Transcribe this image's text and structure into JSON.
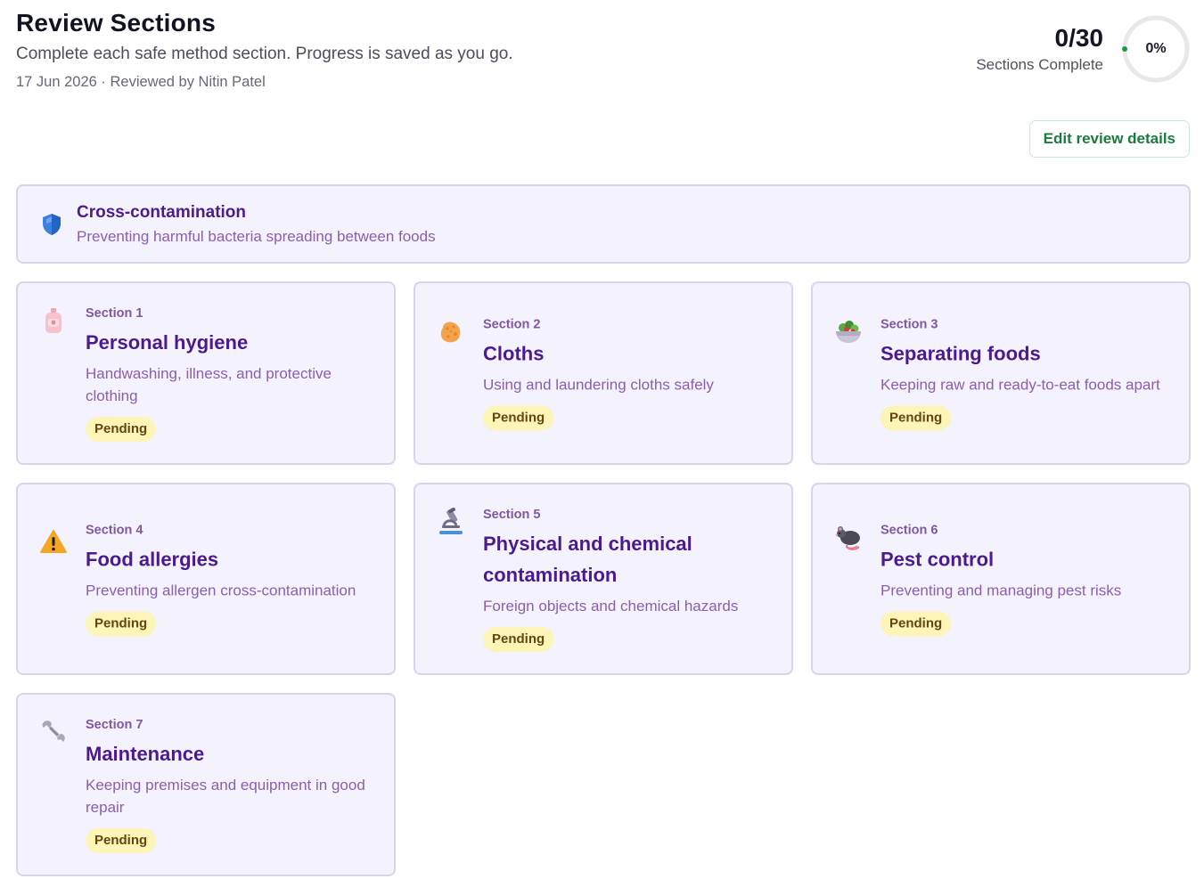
{
  "header": {
    "title": "Review Sections",
    "subtitle": "Complete each safe method section. Progress is saved as you go.",
    "meta": "17 Jun 2026 · Reviewed by Nitin Patel"
  },
  "progress": {
    "count": "0/30",
    "label": "Sections Complete",
    "percent_label": "0%",
    "percent": 0
  },
  "edit_button": {
    "label": "Edit review details"
  },
  "category": {
    "title": "Cross-contamination",
    "description": "Preventing harmful bacteria spreading between foods",
    "icon": "shield-icon"
  },
  "sections": [
    {
      "number": "Section 1",
      "title": "Personal hygiene",
      "description": "Handwashing, illness, and protective clothing",
      "status": "Pending",
      "icon": "soap-icon"
    },
    {
      "number": "Section 2",
      "title": "Cloths",
      "description": "Using and laundering cloths safely",
      "status": "Pending",
      "icon": "sponge-icon"
    },
    {
      "number": "Section 3",
      "title": "Separating foods",
      "description": "Keeping raw and ready-to-eat foods apart",
      "status": "Pending",
      "icon": "salad-bowl-icon"
    },
    {
      "number": "Section 4",
      "title": "Food allergies",
      "description": "Preventing allergen cross-contamination",
      "status": "Pending",
      "icon": "warning-icon"
    },
    {
      "number": "Section 5",
      "title": "Physical and chemical contamination",
      "description": "Foreign objects and chemical hazards",
      "status": "Pending",
      "icon": "microscope-icon"
    },
    {
      "number": "Section 6",
      "title": "Pest control",
      "description": "Preventing and managing pest risks",
      "status": "Pending",
      "icon": "rat-icon"
    },
    {
      "number": "Section 7",
      "title": "Maintenance",
      "description": "Keeping premises and equipment in good repair",
      "status": "Pending",
      "icon": "wrench-icon"
    }
  ],
  "colors": {
    "accent_purple": "#4a1a90",
    "card_bg": "#f4f2fd",
    "card_border": "#d9d3ee",
    "badge_bg": "#fdf4b8",
    "button_green": "#1d7a3d",
    "progress_dot": "#1a9b3c"
  }
}
